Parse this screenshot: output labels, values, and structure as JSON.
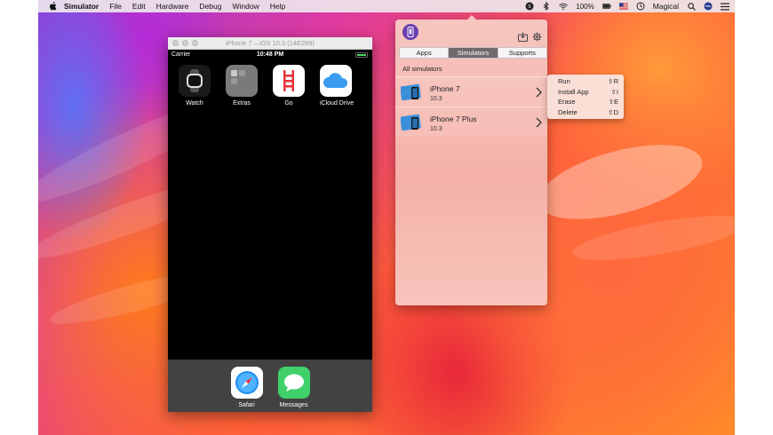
{
  "menubar": {
    "app_name": "Simulator",
    "items": [
      "File",
      "Edit",
      "Hardware",
      "Debug",
      "Window",
      "Help"
    ],
    "battery": "100%",
    "user": "Magical"
  },
  "simulator_window": {
    "title": "iPhone 7 – iOS 10.3 (14E269)",
    "carrier": "Carrier",
    "time": "10:48 PM",
    "home_apps": [
      {
        "label": "Watch"
      },
      {
        "label": "Extras"
      },
      {
        "label": "Go"
      },
      {
        "label": "iCloud Drive"
      }
    ],
    "dock_apps": [
      {
        "label": "Safari"
      },
      {
        "label": "Messages"
      }
    ]
  },
  "panel": {
    "tabs": [
      "Apps",
      "Simulators",
      "Supports"
    ],
    "active_tab": "Simulators",
    "section_title": "All simulators",
    "simulators": [
      {
        "name": "iPhone 7",
        "version": "10.3"
      },
      {
        "name": "iPhone 7 Plus",
        "version": "10.3"
      }
    ]
  },
  "context_menu": {
    "items": [
      {
        "label": "Run",
        "shortcut": "⇧R"
      },
      {
        "label": "Install App",
        "shortcut": "⇧I"
      },
      {
        "label": "Erase",
        "shortcut": "⇧E"
      },
      {
        "label": "Delete",
        "shortcut": "⇧D"
      }
    ]
  },
  "colors": {
    "panel_bg": "#f4b1a8",
    "active_tab": "#6f6a6d",
    "logo": "#6a3fb0"
  }
}
